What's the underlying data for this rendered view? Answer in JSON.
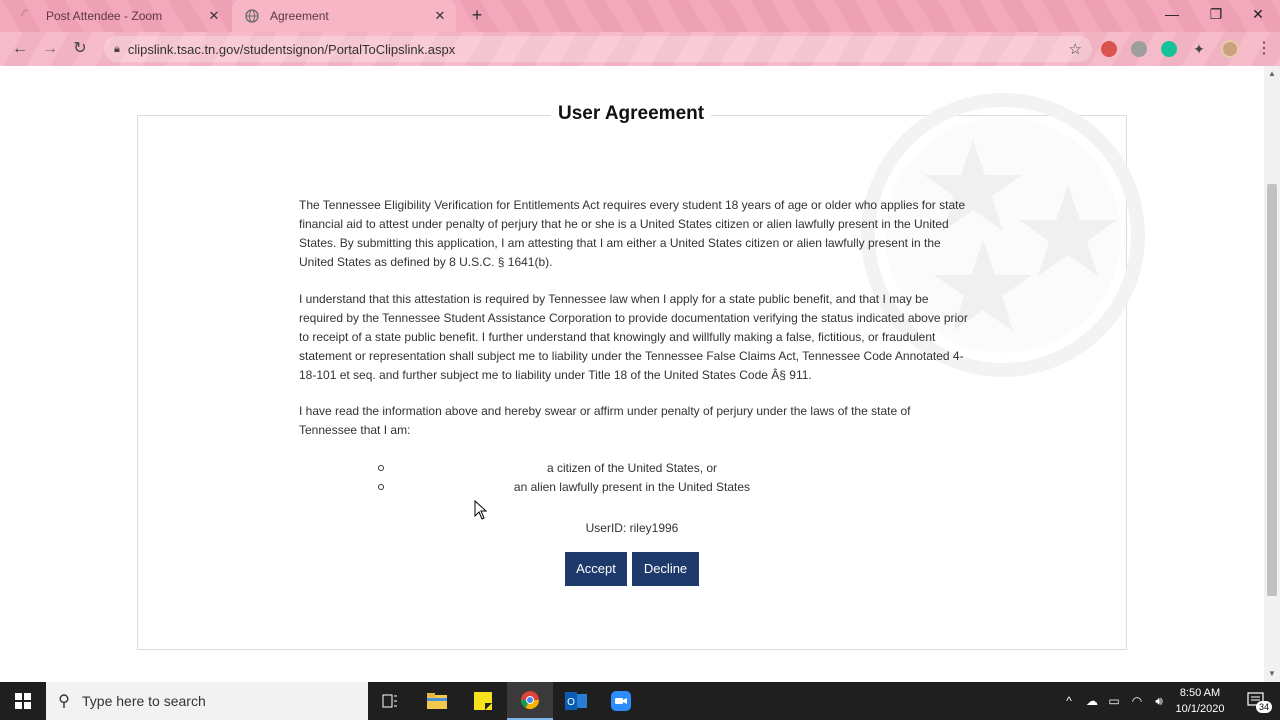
{
  "browser": {
    "tabs": [
      {
        "title": "Post Attendee - Zoom",
        "active": false
      },
      {
        "title": "Agreement",
        "active": true
      }
    ],
    "url": "clipslink.tsac.tn.gov/studentsignon/PortalToClipslink.aspx"
  },
  "agreement": {
    "heading": "User Agreement",
    "paragraphs": [
      "The Tennessee Eligibility Verification for Entitlements Act requires every student 18 years of age or older who applies for state financial aid to attest under penalty of perjury that he or she is a United States citizen or alien lawfully present in the United States. By submitting this application, I am attesting that I am either a United States citizen or alien lawfully present in the United States as defined by 8 U.S.C. § 1641(b).",
      "I understand that this attestation is required by Tennessee law when I apply for a state public benefit, and that I may be required by the Tennessee Student Assistance Corporation to provide documentation verifying the status indicated above prior to receipt of a state public benefit. I further understand that knowingly and willfully making a false, fictitious, or fraudulent statement or representation shall subject me to liability under the Tennessee False Claims Act, Tennessee Code Annotated 4-18-101 et seq. and further subject me to liability under Title 18 of the United States Code Â§ 911.",
      "I have read the information above and hereby swear or affirm under penalty of perjury under the laws of the state of Tennessee that I am:"
    ],
    "options": [
      "a citizen of the United States, or",
      "an alien lawfully present in the United States"
    ],
    "userid": "UserID: riley1996",
    "accept_label": "Accept",
    "decline_label": "Decline"
  },
  "taskbar": {
    "search_placeholder": "Type here to search",
    "time": "8:50 AM",
    "date": "10/1/2020",
    "notification_count": "34"
  },
  "colors": {
    "chrome_pink": "#f3a3b8",
    "button_navy": "#1e3a6b"
  }
}
